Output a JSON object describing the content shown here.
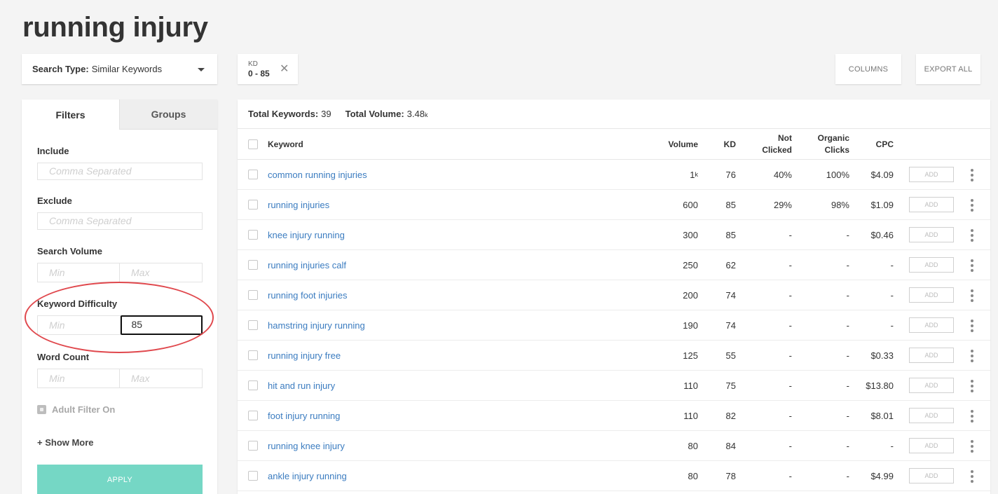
{
  "page": {
    "title": "running injury"
  },
  "search_type": {
    "label": "Search Type:",
    "value": "Similar Keywords",
    "icon": "caret-down-icon"
  },
  "kd_chip": {
    "label": "KD",
    "value": "0 - 85",
    "close_icon": "close-icon"
  },
  "toolbar": {
    "columns_label": "COLUMNS",
    "export_label": "EXPORT ALL"
  },
  "sidebar": {
    "tabs": [
      {
        "label": "Filters",
        "active": true
      },
      {
        "label": "Groups",
        "active": false
      }
    ],
    "include": {
      "label": "Include",
      "placeholder": "Comma Separated"
    },
    "exclude": {
      "label": "Exclude",
      "placeholder": "Comma Separated"
    },
    "search_volume": {
      "label": "Search Volume",
      "min_placeholder": "Min",
      "max_placeholder": "Max"
    },
    "keyword_difficulty": {
      "label": "Keyword Difficulty",
      "min_placeholder": "Min",
      "max_value": "85"
    },
    "word_count": {
      "label": "Word Count",
      "min_placeholder": "Min",
      "max_placeholder": "Max"
    },
    "adult_filter": {
      "label": "Adult Filter On"
    },
    "show_more": "+ Show More",
    "apply": "APPLY"
  },
  "annotation": {
    "color": "#e0484d",
    "target": "Keyword Difficulty"
  },
  "table": {
    "totals": {
      "keywords_label": "Total Keywords:",
      "keywords_value": "39",
      "volume_label": "Total Volume:",
      "volume_value": "3.48",
      "volume_suffix": "k"
    },
    "headers": {
      "keyword": "Keyword",
      "volume": "Volume",
      "kd": "KD",
      "not_clicked_1": "Not",
      "not_clicked_2": "Clicked",
      "organic_1": "Organic",
      "organic_2": "Clicks",
      "cpc": "CPC"
    },
    "add_label": "ADD",
    "rows": [
      {
        "keyword": "common running injuries",
        "volume": "1",
        "volume_suffix": "k",
        "kd": "76",
        "not_clicked": "40%",
        "organic": "100%",
        "cpc": "$4.09"
      },
      {
        "keyword": "running injuries",
        "volume": "600",
        "volume_suffix": "",
        "kd": "85",
        "not_clicked": "29%",
        "organic": "98%",
        "cpc": "$1.09"
      },
      {
        "keyword": "knee injury running",
        "volume": "300",
        "volume_suffix": "",
        "kd": "85",
        "not_clicked": "-",
        "organic": "-",
        "cpc": "$0.46"
      },
      {
        "keyword": "running injuries calf",
        "volume": "250",
        "volume_suffix": "",
        "kd": "62",
        "not_clicked": "-",
        "organic": "-",
        "cpc": "-"
      },
      {
        "keyword": "running foot injuries",
        "volume": "200",
        "volume_suffix": "",
        "kd": "74",
        "not_clicked": "-",
        "organic": "-",
        "cpc": "-"
      },
      {
        "keyword": "hamstring injury running",
        "volume": "190",
        "volume_suffix": "",
        "kd": "74",
        "not_clicked": "-",
        "organic": "-",
        "cpc": "-"
      },
      {
        "keyword": "running injury free",
        "volume": "125",
        "volume_suffix": "",
        "kd": "55",
        "not_clicked": "-",
        "organic": "-",
        "cpc": "$0.33"
      },
      {
        "keyword": "hit and run injury",
        "volume": "110",
        "volume_suffix": "",
        "kd": "75",
        "not_clicked": "-",
        "organic": "-",
        "cpc": "$13.80"
      },
      {
        "keyword": "foot injury running",
        "volume": "110",
        "volume_suffix": "",
        "kd": "82",
        "not_clicked": "-",
        "organic": "-",
        "cpc": "$8.01"
      },
      {
        "keyword": "running knee injury",
        "volume": "80",
        "volume_suffix": "",
        "kd": "84",
        "not_clicked": "-",
        "organic": "-",
        "cpc": "-"
      },
      {
        "keyword": "ankle injury running",
        "volume": "80",
        "volume_suffix": "",
        "kd": "78",
        "not_clicked": "-",
        "organic": "-",
        "cpc": "$4.99"
      }
    ]
  }
}
